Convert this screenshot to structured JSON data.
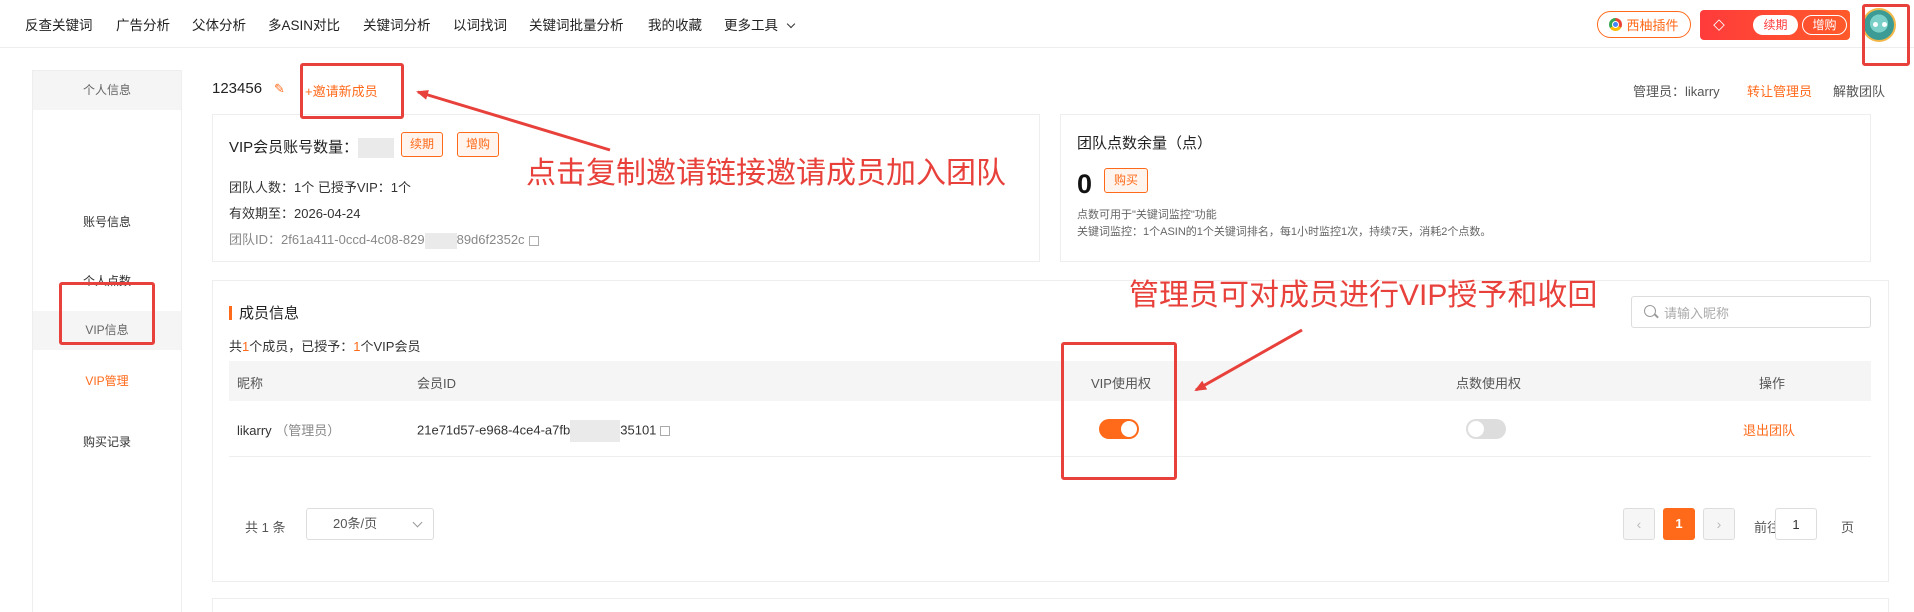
{
  "nav": {
    "items": [
      "反查关键词",
      "广告分析",
      "父体分析",
      "多ASIN对比",
      "关键词分析",
      "以词找词",
      "关键词批量分析",
      "我的收藏",
      "更多工具"
    ],
    "plugin_label": "西柚插件",
    "renew_label": "续期",
    "upgrade_label": "增购"
  },
  "sidebar": {
    "group_personal": "个人信息",
    "account_info": "账号信息",
    "personal_points": "个人点数",
    "group_vip": "VIP信息",
    "vip_manage": "VIP管理",
    "purchase_records": "购买记录"
  },
  "team": {
    "name": "123456",
    "invite_label": "+邀请新成员",
    "admin_label": "管理员：likarry",
    "transfer_label": "转让管理员",
    "disband_label": "解散团队"
  },
  "vip_card": {
    "title": "VIP会员账号数量：",
    "renew_label": "续期",
    "upgrade_label": "增购",
    "members_line": "团队人数：1个   已授予VIP：1个",
    "expiry_line": "有效期至：2026-04-24",
    "team_id_prefix": "团队ID：2f61a411-0ccd-4c08-829",
    "team_id_suffix": "89d6f2352c"
  },
  "points_card": {
    "title": "团队点数余量（点）",
    "value": "0",
    "buy_label": "购买",
    "note1": "点数可用于\"关键词监控\"功能",
    "note2": "关键词监控：1个ASIN的1个关键词排名，每1小时监控1次，持续7天，消耗2个点数。"
  },
  "members": {
    "title": "成员信息",
    "summary_pre": "共",
    "summary_count": "1",
    "summary_mid": "个成员，已授予：",
    "summary_vip": "1",
    "summary_post": "个VIP会员",
    "search_placeholder": "请输入昵称",
    "columns": {
      "nickname": "昵称",
      "member_id": "会员ID",
      "vip_right": "VIP使用权",
      "points_right": "点数使用权",
      "actions": "操作"
    },
    "rows": [
      {
        "nickname": "likarry",
        "role": "（管理员）",
        "id_prefix": "21e71d57-e968-4ce4-a7fb",
        "id_suffix": "35101",
        "vip_enabled": true,
        "points_enabled": false,
        "action": "退出团队"
      }
    ]
  },
  "pagination": {
    "total": "共 1 条",
    "page_size": "20条/页",
    "prev": "‹",
    "next": "›",
    "current": "1",
    "goto_prefix": "前往",
    "goto_value": "1",
    "goto_suffix": "页"
  },
  "annotations": {
    "invite_text": "点击复制邀请链接邀请成员加入团队",
    "vip_text": "管理员可对成员进行VIP授予和收回"
  },
  "colors": {
    "accent": "#ff6a1a",
    "annotation": "#e8403a"
  }
}
